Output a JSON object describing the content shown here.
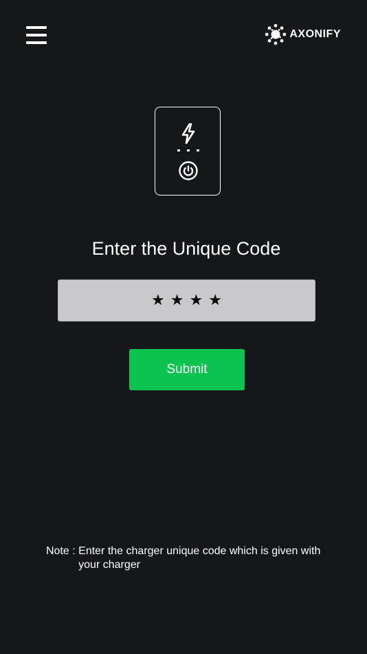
{
  "header": {
    "menu_icon": "hamburger-menu-icon",
    "brand_name": "AXONIFY",
    "brand_icon": "axonify-logo-icon"
  },
  "illustration": {
    "bolt_icon": "lightning-bolt-icon",
    "power_icon": "power-icon"
  },
  "form": {
    "title": "Enter the Unique Code",
    "code_masked": "★★★★",
    "submit_label": "Submit"
  },
  "note": {
    "label": "Note : ",
    "text": "Enter the charger unique code which is given with your charger"
  },
  "colors": {
    "background": "#15171b",
    "accent": "#0bc44f",
    "field": "#c9c9cb"
  }
}
